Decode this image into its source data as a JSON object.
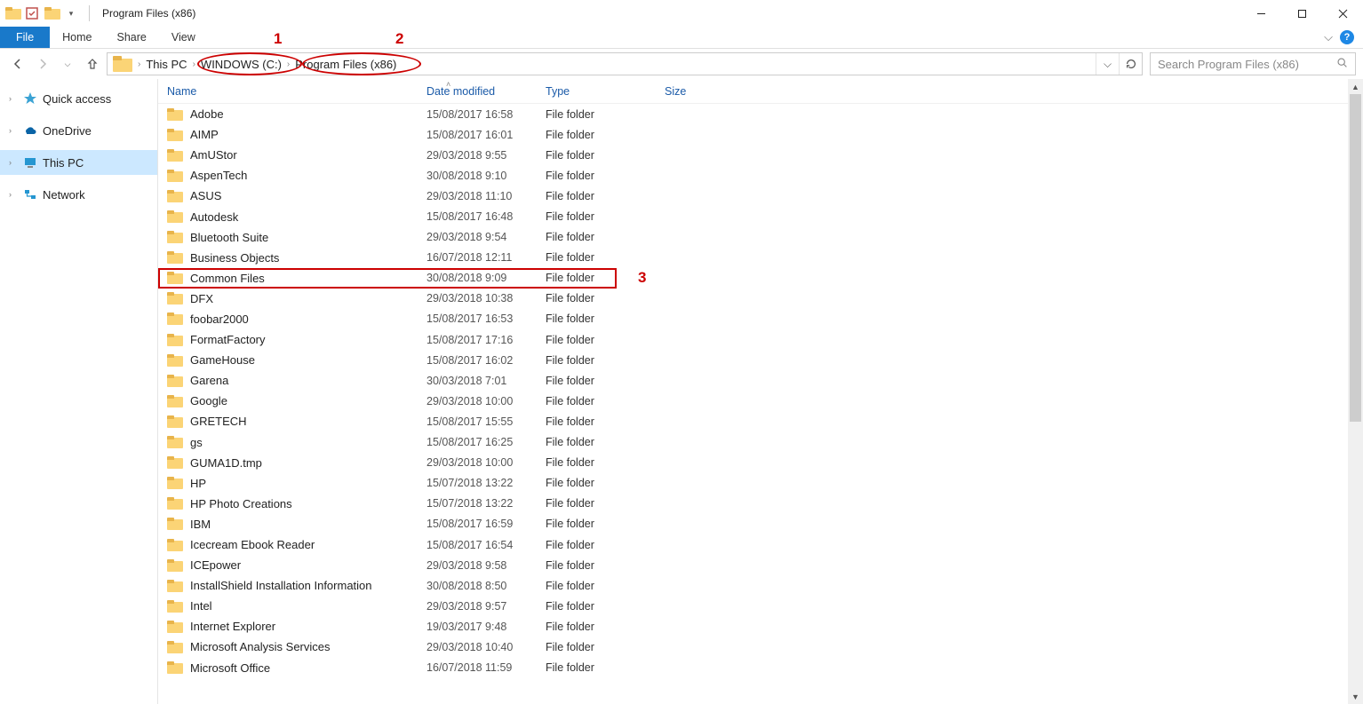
{
  "window": {
    "title": "Program Files (x86)"
  },
  "ribbon": {
    "file": "File",
    "home": "Home",
    "share": "Share",
    "view": "View",
    "help": "?"
  },
  "breadcrumb": {
    "seg0": "This PC",
    "seg1": "WINDOWS (C:)",
    "seg2": "Program Files (x86)"
  },
  "search": {
    "placeholder": "Search Program Files (x86)"
  },
  "navpane": {
    "quick_access": "Quick access",
    "onedrive": "OneDrive",
    "this_pc": "This PC",
    "network": "Network"
  },
  "columns": {
    "name": "Name",
    "date": "Date modified",
    "type": "Type",
    "size": "Size"
  },
  "type_label": "File folder",
  "rows": [
    {
      "name": "Adobe",
      "date": "15/08/2017 16:58"
    },
    {
      "name": "AIMP",
      "date": "15/08/2017 16:01"
    },
    {
      "name": "AmUStor",
      "date": "29/03/2018 9:55"
    },
    {
      "name": "AspenTech",
      "date": "30/08/2018 9:10"
    },
    {
      "name": "ASUS",
      "date": "29/03/2018 11:10"
    },
    {
      "name": "Autodesk",
      "date": "15/08/2017 16:48"
    },
    {
      "name": "Bluetooth Suite",
      "date": "29/03/2018 9:54"
    },
    {
      "name": "Business Objects",
      "date": "16/07/2018 12:11"
    },
    {
      "name": "Common Files",
      "date": "30/08/2018 9:09"
    },
    {
      "name": "DFX",
      "date": "29/03/2018 10:38"
    },
    {
      "name": "foobar2000",
      "date": "15/08/2017 16:53"
    },
    {
      "name": "FormatFactory",
      "date": "15/08/2017 17:16"
    },
    {
      "name": "GameHouse",
      "date": "15/08/2017 16:02"
    },
    {
      "name": "Garena",
      "date": "30/03/2018 7:01"
    },
    {
      "name": "Google",
      "date": "29/03/2018 10:00"
    },
    {
      "name": "GRETECH",
      "date": "15/08/2017 15:55"
    },
    {
      "name": "gs",
      "date": "15/08/2017 16:25"
    },
    {
      "name": "GUMA1D.tmp",
      "date": "29/03/2018 10:00"
    },
    {
      "name": "HP",
      "date": "15/07/2018 13:22"
    },
    {
      "name": "HP Photo Creations",
      "date": "15/07/2018 13:22"
    },
    {
      "name": "IBM",
      "date": "15/08/2017 16:59"
    },
    {
      "name": "Icecream Ebook Reader",
      "date": "15/08/2017 16:54"
    },
    {
      "name": "ICEpower",
      "date": "29/03/2018 9:58"
    },
    {
      "name": "InstallShield Installation Information",
      "date": "30/08/2018 8:50"
    },
    {
      "name": "Intel",
      "date": "29/03/2018 9:57"
    },
    {
      "name": "Internet Explorer",
      "date": "19/03/2017 9:48"
    },
    {
      "name": "Microsoft Analysis Services",
      "date": "29/03/2018 10:40"
    },
    {
      "name": "Microsoft Office",
      "date": "16/07/2018 11:59"
    }
  ],
  "annotations": {
    "n1": "1",
    "n2": "2",
    "n3": "3"
  }
}
